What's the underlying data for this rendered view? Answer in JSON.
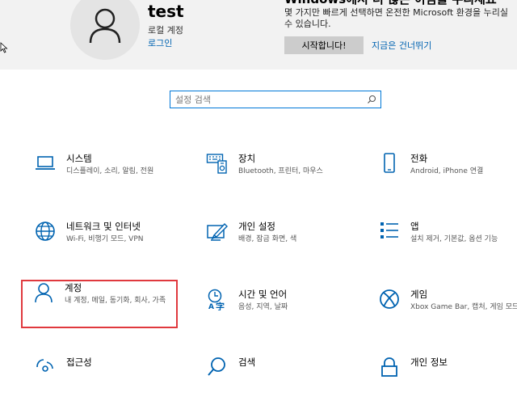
{
  "account": {
    "username": "test",
    "type": "로컬 계정",
    "signin_link": "로그인"
  },
  "promo": {
    "title": "Windows에서 더 많은 이점을 누리세요",
    "description": "몇 가지만 빠르게 선택하면 온전한 Microsoft 환경을 누리실 수 있습니다.",
    "start_button": "시작합니다!",
    "skip_link": "지금은 건너뛰기"
  },
  "search": {
    "placeholder": "설정 검색",
    "value": ""
  },
  "tiles": [
    {
      "title": "시스템",
      "desc": "디스플레이, 소리, 알림, 전원",
      "icon": "laptop-icon"
    },
    {
      "title": "장치",
      "desc": "Bluetooth, 프린터, 마우스",
      "icon": "devices-icon"
    },
    {
      "title": "전화",
      "desc": "Android, iPhone 연결",
      "icon": "phone-icon"
    },
    {
      "title": "네트워크 및 인터넷",
      "desc": "Wi-Fi, 비행기 모드, VPN",
      "icon": "globe-icon"
    },
    {
      "title": "개인 설정",
      "desc": "배경, 잠금 화면, 색",
      "icon": "personalization-icon"
    },
    {
      "title": "앱",
      "desc": "설치 제거, 기본값, 옵션 기능",
      "icon": "apps-icon"
    },
    {
      "title": "계정",
      "desc": "내 계정, 메일, 동기화, 회사, 가족",
      "icon": "person-icon"
    },
    {
      "title": "시간 및 언어",
      "desc": "음성, 지역, 날짜",
      "icon": "time-language-icon"
    },
    {
      "title": "게임",
      "desc": "Xbox Game Bar, 캡처, 게임 모드",
      "icon": "xbox-icon"
    },
    {
      "title": "접근성",
      "desc": "",
      "icon": "ease-of-access-icon"
    },
    {
      "title": "검색",
      "desc": "",
      "icon": "search-icon"
    },
    {
      "title": "개인 정보",
      "desc": "",
      "icon": "lock-icon"
    }
  ],
  "colors": {
    "accent": "#0063b1",
    "selection_outline": "#e0393e",
    "band": "#f2f2f2"
  }
}
